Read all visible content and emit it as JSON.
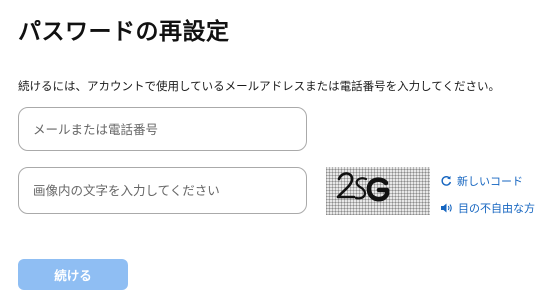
{
  "page": {
    "title": "パスワードの再設定",
    "description": "続けるには、アカウントで使用しているメールアドレスまたは電話番号を入力してください。"
  },
  "form": {
    "identifier_placeholder": "メールまたは電話番号",
    "identifier_value": "",
    "captcha_placeholder": "画像内の文字を入力してください",
    "captcha_value": ""
  },
  "captcha": {
    "image_text": "2SG",
    "new_code_label": "新しいコード",
    "audio_label": "目の不自由な方",
    "new_code_icon": "refresh-icon",
    "audio_icon": "speaker-icon"
  },
  "actions": {
    "continue_label": "続ける"
  },
  "colors": {
    "primary_disabled": "#8fbef3",
    "link": "#1565c0",
    "border": "#aaaaaa"
  }
}
